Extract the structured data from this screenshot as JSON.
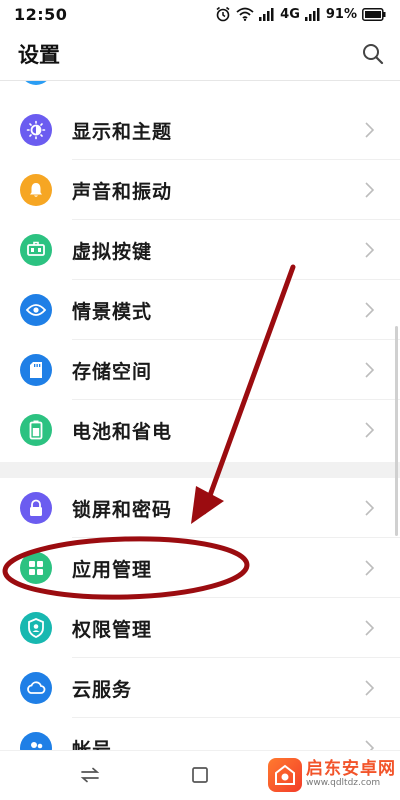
{
  "status_bar": {
    "time": "12:50",
    "network": "4G",
    "battery": "91%"
  },
  "header": {
    "title": "设置",
    "search_icon": "search-icon"
  },
  "settings": {
    "items": [
      {
        "label": "显示和主题",
        "icon": "brightness-icon",
        "color": "#6b5cf0"
      },
      {
        "label": "声音和振动",
        "icon": "bell-icon",
        "color": "#f6a623"
      },
      {
        "label": "虚拟按键",
        "icon": "keys-icon",
        "color": "#2cc281"
      },
      {
        "label": "情景模式",
        "icon": "eye-icon",
        "color": "#1f7fe6"
      },
      {
        "label": "存储空间",
        "icon": "sd-card-icon",
        "color": "#1f7fe6"
      },
      {
        "label": "电池和省电",
        "icon": "battery-icon",
        "color": "#2cc281"
      },
      {
        "label": "锁屏和密码",
        "icon": "lock-icon",
        "color": "#6b5cf0"
      },
      {
        "label": "应用管理",
        "icon": "grid-icon",
        "color": "#2cc281"
      },
      {
        "label": "权限管理",
        "icon": "shield-user-icon",
        "color": "#18b8b0"
      },
      {
        "label": "云服务",
        "icon": "cloud-icon",
        "color": "#1f7fe6"
      },
      {
        "label": "帐号",
        "icon": "account-icon",
        "color": "#1f7fe6"
      }
    ]
  },
  "annotation": {
    "arrow_color": "#9b0c10",
    "highlight_target": "应用管理"
  },
  "watermark": {
    "title": "启东安卓网",
    "url": "www.qdltdz.com"
  }
}
